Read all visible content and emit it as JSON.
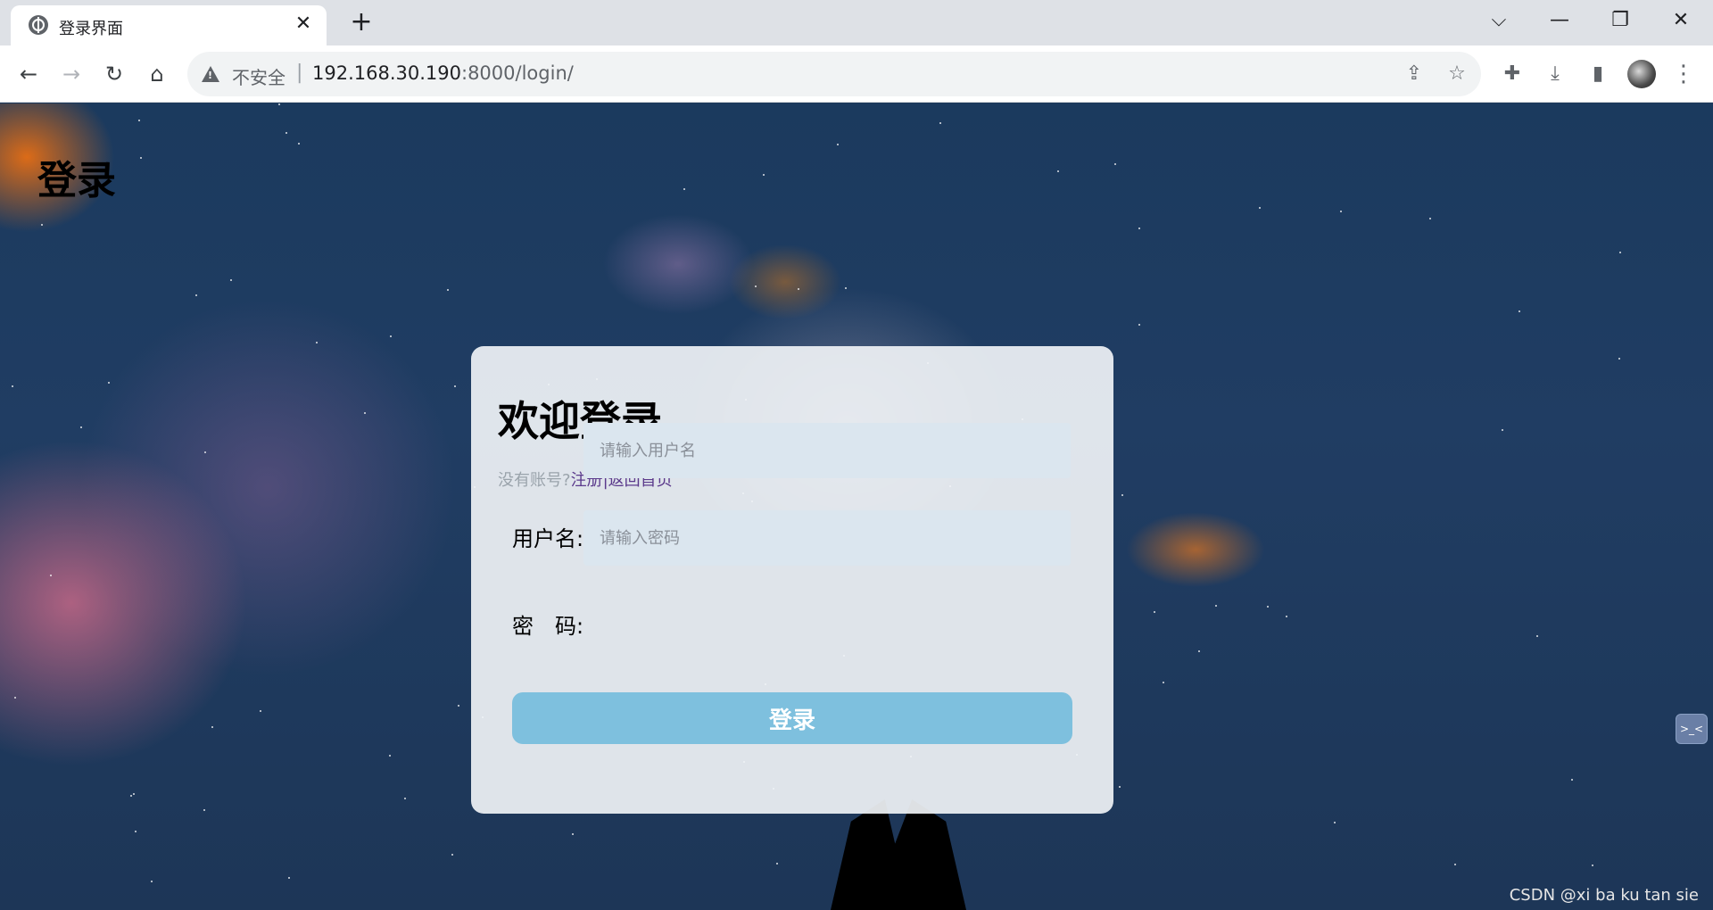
{
  "browser": {
    "tab_title": "登录界面",
    "tab_close": "✕",
    "new_tab": "+",
    "window_controls": {
      "menu": "⌵",
      "minimize": "—",
      "restore": "❐",
      "close": "✕"
    },
    "nav": {
      "back": "←",
      "forward": "→",
      "reload": "↻",
      "home": "⌂"
    },
    "security_label": "不安全",
    "separator": "|",
    "url_host": "192.168.30.190",
    "url_path": ":8000/login/",
    "icons": {
      "share": "⇪",
      "star": "☆",
      "extensions": "✚",
      "download": "⤓",
      "sidepanel": "▮",
      "menu": "⋮"
    }
  },
  "page": {
    "heading": "登录",
    "card": {
      "title": "欢迎登录",
      "hint_text": "没有账号?",
      "register_link": "注册",
      "link_separator": "|",
      "home_link": "返回首页",
      "username_label": "用户名:",
      "username_placeholder": "请输入用户名",
      "password_label": "密　码:",
      "password_placeholder": "请输入密码",
      "submit_label": "登录"
    },
    "side_widget": ">_<",
    "watermark": "CSDN @xi ba ku tan sie"
  }
}
